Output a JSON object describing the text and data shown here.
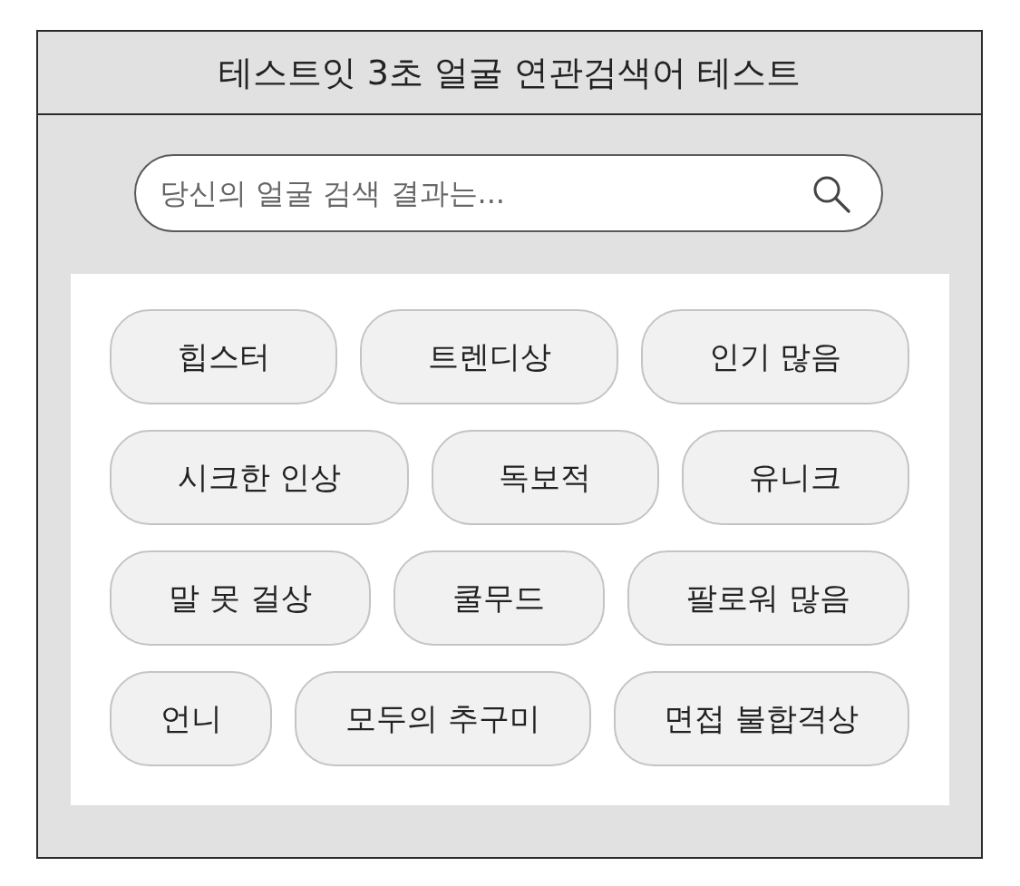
{
  "title": "테스트잇 3초 얼굴 연관검색어 테스트",
  "search": {
    "placeholder": "당신의 얼굴 검색 결과는..."
  },
  "keyword_rows": [
    [
      "힙스터",
      "트렌디상",
      "인기 많음"
    ],
    [
      "시크한 인상",
      "독보적",
      "유니크"
    ],
    [
      "말 못 걸상",
      "쿨무드",
      "팔로워 많음"
    ],
    [
      "언니",
      "모두의 추구미",
      "면접 불합격상"
    ]
  ]
}
